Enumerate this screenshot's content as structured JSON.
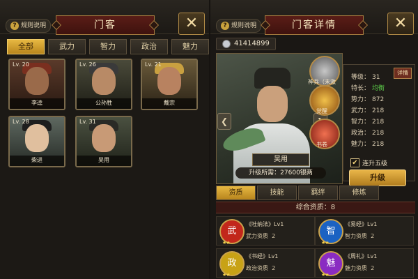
{
  "left": {
    "rules_label": "规则说明",
    "title": "门客",
    "close": "✕",
    "tabs": [
      "全部",
      "武力",
      "智力",
      "政治",
      "魅力"
    ],
    "heroes": [
      {
        "level": "Lv. 20",
        "name": "李逵"
      },
      {
        "level": "Lv. 26",
        "name": "公孙胜"
      },
      {
        "level": "Lv. 21",
        "name": "戴宗"
      },
      {
        "level": "Lv. 28",
        "name": "柴进"
      },
      {
        "level": "Lv. 31",
        "name": "吴用"
      }
    ]
  },
  "right": {
    "rules_label": "规则说明",
    "title": "门客详情",
    "close": "✕",
    "silver": "41414899",
    "hero_name": "吴用",
    "upgrade_cost": "升级所需：27600银两",
    "skills": [
      {
        "label": "神兵（未激活）"
      },
      {
        "label": "觉醒"
      },
      {
        "label": "书卷"
      }
    ],
    "detail_button": "详情",
    "stats": [
      {
        "label": "等级：",
        "value": "31"
      },
      {
        "label": "特长：",
        "value": "均衡"
      },
      {
        "label": "势力：",
        "value": "872"
      },
      {
        "label": "武力：",
        "value": "218"
      },
      {
        "label": "智力：",
        "value": "218"
      },
      {
        "label": "政治：",
        "value": "218"
      },
      {
        "label": "魅力：",
        "value": "218"
      }
    ],
    "checkbox_label": "连升五级",
    "upgrade_button": "升级",
    "tabs": [
      "资质",
      "技能",
      "羁绊",
      "修炼"
    ],
    "overall": "综合资质：8",
    "books": [
      {
        "title": "《吐纳法》Lv1",
        "attr": "武力资质",
        "value": "2",
        "glyph": "武",
        "color": "#c2271b"
      },
      {
        "title": "《易经》Lv1",
        "attr": "智力资质",
        "value": "2",
        "glyph": "智",
        "color": "#1b62c2"
      },
      {
        "title": "《书经》Lv1",
        "attr": "政治资质",
        "value": "2",
        "glyph": "政",
        "color": "#c8a216"
      },
      {
        "title": "《周礼》Lv1",
        "attr": "魅力资质",
        "value": "2",
        "glyph": "魅",
        "color": "#8a2bc2"
      }
    ]
  },
  "colors": {
    "accent_gold": "#e7b842",
    "title_red": "#5a1d17",
    "green": "#5ed04a"
  }
}
